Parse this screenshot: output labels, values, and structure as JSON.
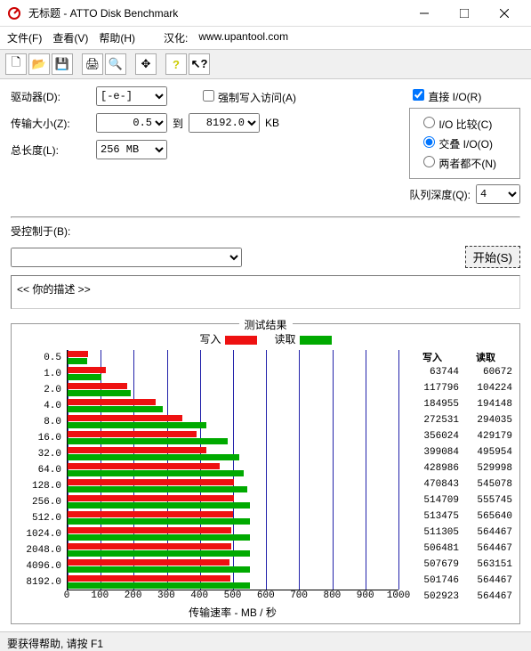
{
  "window": {
    "title": "无标题 - ATTO Disk Benchmark"
  },
  "menu": {
    "file": "文件(F)",
    "view": "查看(V)",
    "help": "帮助(H)",
    "hanhua_label": "汉化:",
    "hanhua_url": "www.upantool.com"
  },
  "form": {
    "drive_label": "驱动器(D):",
    "drive_value": "[-e-]",
    "transfer_label": "传输大小(Z):",
    "transfer_from": "0.5",
    "to_label": "到",
    "transfer_to": "8192.0",
    "unit": "KB",
    "total_label": "总长度(L):",
    "total_value": "256 MB",
    "force_write": "强制写入访问(A)",
    "direct_io": "直接 I/O(R)",
    "io_compare": "I/O 比较(C)",
    "overlap_io": "交叠 I/O(O)",
    "neither": "两者都不(N)",
    "queue_label": "队列深度(Q):",
    "queue_value": "4",
    "controlled_label": "受控制于(B):",
    "start_btn": "开始(S)",
    "description": "<<   你的描述   >>"
  },
  "results": {
    "title": "测试结果",
    "legend_write": "写入",
    "legend_read": "读取",
    "col_write": "写入",
    "col_read": "读取",
    "xlabel": "传输速率 - MB / 秒"
  },
  "chart_data": {
    "type": "bar",
    "xlabel": "传输速率 - MB / 秒",
    "xlim": [
      0,
      1000
    ],
    "x_ticks": [
      0,
      100,
      200,
      300,
      400,
      500,
      600,
      700,
      800,
      900,
      1000
    ],
    "categories": [
      "0.5",
      "1.0",
      "2.0",
      "4.0",
      "8.0",
      "16.0",
      "32.0",
      "64.0",
      "128.0",
      "256.0",
      "512.0",
      "1024.0",
      "2048.0",
      "4096.0",
      "8192.0"
    ],
    "series": [
      {
        "name": "写入",
        "color": "#e11",
        "values": [
          63744,
          117796,
          184955,
          272531,
          356024,
          399084,
          428986,
          470843,
          514709,
          513475,
          511305,
          506481,
          507679,
          501746,
          502923
        ]
      },
      {
        "name": "读取",
        "color": "#0a0",
        "values": [
          60672,
          104224,
          194148,
          294035,
          429179,
          495954,
          529998,
          545078,
          555745,
          565640,
          564467,
          564467,
          563151,
          564467,
          564467
        ]
      }
    ]
  },
  "status": "要获得帮助, 请按 F1"
}
